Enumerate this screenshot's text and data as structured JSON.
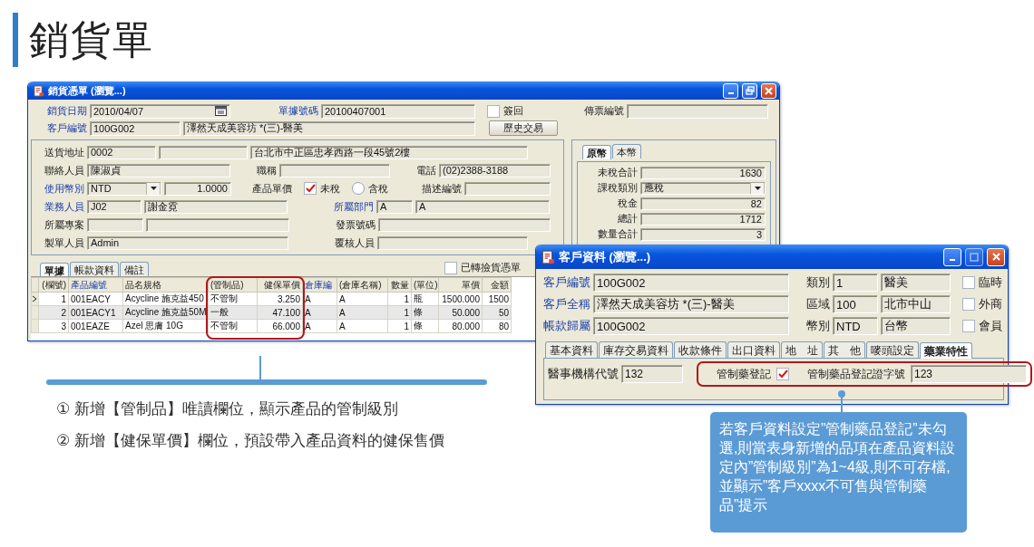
{
  "page_title": "銷貨單",
  "sales_window": {
    "title": "銷貨憑單 (瀏覽...)",
    "header_rows": [
      [
        {
          "kind": "label",
          "text": "銷貨日期",
          "link": true
        },
        {
          "kind": "date_field",
          "value": "2010/04/07"
        },
        {
          "kind": "label",
          "text": "單據號碼",
          "link": true
        },
        {
          "kind": "field",
          "value": "20100407001"
        },
        {
          "kind": "checkbox",
          "label": "簽回",
          "checked": false
        },
        {
          "kind": "label",
          "text": "傳票編號",
          "link": false
        },
        {
          "kind": "field"
        }
      ],
      [
        {
          "kind": "label",
          "text": "客戶編號",
          "link": true
        },
        {
          "kind": "field",
          "value": "100G002"
        },
        {
          "kind": "field",
          "value": "澤然天成美容坊 *(三)-醫美"
        },
        {
          "kind": "button",
          "label": "歷史交易"
        }
      ]
    ],
    "detail_rows": [
      [
        {
          "kind": "label",
          "text": "送貨地址",
          "link": false
        },
        {
          "kind": "field",
          "value": "0002"
        },
        {
          "kind": "field"
        },
        {
          "kind": "field",
          "value": "台北市中正區忠孝西路一段45號2樓"
        }
      ],
      [
        {
          "kind": "label",
          "text": "聯絡人員",
          "link": false
        },
        {
          "kind": "field",
          "value": "陳淑貞"
        },
        {
          "kind": "label",
          "text": "職稱",
          "link": false
        },
        {
          "kind": "field"
        },
        {
          "kind": "label",
          "text": "電話",
          "link": false
        },
        {
          "kind": "field",
          "value": "(02)2388-3188"
        }
      ],
      [
        {
          "kind": "label",
          "text": "使用幣別",
          "link": true
        },
        {
          "kind": "dropdown",
          "value": "NTD"
        },
        {
          "kind": "number_field",
          "value": "1.0000"
        },
        {
          "kind": "label",
          "text": "產品單價",
          "link": false
        },
        {
          "kind": "checkbox",
          "label": "未稅",
          "checked": true
        },
        {
          "kind": "radio",
          "label": "含稅",
          "selected": false
        },
        {
          "kind": "label",
          "text": "描述編號",
          "link": false
        },
        {
          "kind": "field"
        }
      ],
      [
        {
          "kind": "label",
          "text": "業務人員",
          "link": true
        },
        {
          "kind": "field",
          "value": "J02"
        },
        {
          "kind": "field",
          "value": "謝金霓"
        },
        {
          "kind": "label",
          "text": "所屬部門",
          "link": true
        },
        {
          "kind": "field",
          "value": "A"
        },
        {
          "kind": "field",
          "value": "A"
        }
      ],
      [
        {
          "kind": "label",
          "text": "所屬專案",
          "link": false
        },
        {
          "kind": "field"
        },
        {
          "kind": "field"
        },
        {
          "kind": "label",
          "text": "發票號碼",
          "link": false
        },
        {
          "kind": "field"
        }
      ],
      [
        {
          "kind": "label",
          "text": "製單人員",
          "link": false
        },
        {
          "kind": "field",
          "value": "Admin"
        },
        {
          "kind": "label",
          "text": "覆核人員",
          "link": false
        },
        {
          "kind": "field"
        }
      ]
    ],
    "totals": {
      "tabs": [
        {
          "label": "原幣",
          "selected": true
        },
        {
          "label": "本幣",
          "selected": false
        }
      ],
      "rows": [
        {
          "kind": "number_field",
          "label": "未稅合計",
          "value": "1630"
        },
        {
          "kind": "dropdown",
          "label": "課稅類別",
          "value": "應稅"
        },
        {
          "kind": "number_field",
          "label": "稅金",
          "value": "82"
        },
        {
          "kind": "number_field",
          "label": "總計",
          "value": "1712"
        },
        {
          "kind": "number_field",
          "label": "數量合計",
          "value": "3"
        }
      ]
    },
    "line_tabs": [
      {
        "label": "單據",
        "selected": true
      },
      {
        "label": "帳款資料",
        "selected": false
      },
      {
        "label": "備註",
        "selected": false
      }
    ],
    "transfer_checkbox": {
      "label": "已轉撿貨憑單",
      "checked": false
    },
    "table": {
      "columns": [
        {
          "label": "(欄號)",
          "link": false
        },
        {
          "label": "產品編號",
          "link": true
        },
        {
          "label": "品名規格",
          "link": false
        },
        {
          "label": "(管制品)",
          "link": false
        },
        {
          "label": "健保單價",
          "link": false
        },
        {
          "label": "倉庫編",
          "link": true
        },
        {
          "label": "(倉庫名稱)",
          "link": false
        },
        {
          "label": "數量",
          "link": false
        },
        {
          "label": "(單位)",
          "link": false
        },
        {
          "label": "單價",
          "link": false
        },
        {
          "label": "金額",
          "link": false
        }
      ],
      "rows": [
        {
          "current": true,
          "cells": [
            "1",
            "001EACY",
            "Acycline 施克益450",
            "不管制",
            "3.250",
            "A",
            "A",
            "1",
            "瓶",
            "1500.000",
            "1500"
          ]
        },
        {
          "current": false,
          "cells": [
            "2",
            "001EACY1",
            "Acycline 施克益50M",
            "一般",
            "47.100",
            "A",
            "A",
            "1",
            "條",
            "50.000",
            "50"
          ]
        },
        {
          "current": false,
          "cells": [
            "3",
            "001EAZE",
            "Azel 思膚 10G",
            "不管制",
            "66.000",
            "A",
            "A",
            "1",
            "條",
            "80.000",
            "80"
          ]
        }
      ]
    }
  },
  "customer_window": {
    "title": "客戶資料 (瀏覽...)",
    "rows": [
      [
        {
          "kind": "label",
          "text": "客戶編號",
          "link": true
        },
        {
          "kind": "field",
          "value": "100G002"
        },
        {
          "kind": "label",
          "text": "類別",
          "link": false
        },
        {
          "kind": "field",
          "value": "1"
        },
        {
          "kind": "field",
          "value": "醫美"
        },
        {
          "kind": "checkbox",
          "label": "臨時",
          "checked": false
        }
      ],
      [
        {
          "kind": "label",
          "text": "客戶全稱",
          "link": true
        },
        {
          "kind": "field",
          "value": "澤然天成美容坊 *(三)-醫美"
        },
        {
          "kind": "label",
          "text": "區域",
          "link": false
        },
        {
          "kind": "field",
          "value": "100"
        },
        {
          "kind": "field",
          "value": "北市中山"
        },
        {
          "kind": "checkbox",
          "label": "外商",
          "checked": false
        }
      ],
      [
        {
          "kind": "label",
          "text": "帳款歸屬",
          "link": true
        },
        {
          "kind": "field",
          "value": "100G002"
        },
        {
          "kind": "label",
          "text": "幣別",
          "link": false
        },
        {
          "kind": "field",
          "value": "NTD"
        },
        {
          "kind": "field",
          "value": "台幣"
        },
        {
          "kind": "checkbox",
          "label": "會員",
          "checked": false
        }
      ]
    ],
    "tabs": [
      {
        "label": "基本資料",
        "selected": false
      },
      {
        "label": "庫存交易資料",
        "selected": false
      },
      {
        "label": "收款條件",
        "selected": false
      },
      {
        "label": "出口資料",
        "selected": false
      },
      {
        "label": "地　址",
        "selected": false
      },
      {
        "label": "其　他",
        "selected": false
      },
      {
        "label": "嘜頭設定",
        "selected": false
      },
      {
        "label": "藥業特性",
        "selected": true
      }
    ],
    "medical_code": {
      "label": "醫事機構代號",
      "value": "132"
    },
    "highlighted_fields": [
      {
        "kind": "label",
        "text": "管制藥登記",
        "link": false
      },
      {
        "kind": "checkbox",
        "checked": true
      },
      {
        "kind": "label",
        "text": "管制藥品登記證字號",
        "link": false
      },
      {
        "kind": "field",
        "value": "123"
      }
    ]
  },
  "notes": [
    "① 新增【管制品】唯讀欄位，顯示產品的管制級別",
    "② 新增【健保單價】欄位，預設帶入產品資料的健保售價"
  ],
  "callout": "若客戶資料設定”管制藥品登記”未勾選,則當表身新增的品項在產品資料設定內”管制級別”為1~4級,則不可存檔,並顯示”客戶xxxx不可售與管制藥品”提示"
}
